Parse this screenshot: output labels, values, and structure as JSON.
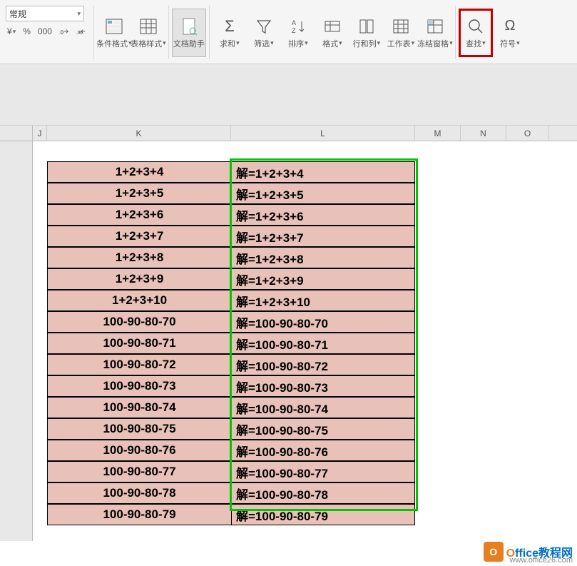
{
  "ribbon": {
    "format_name": "常规",
    "currency": "¥",
    "percent": "%",
    "comma": "000",
    "dec_inc": ".0→.00",
    "dec_dec": ".00→.0",
    "cond_format": "条件格式",
    "table_style": "表格样式",
    "doc_helper": "文档助手",
    "sum": "求和",
    "filter": "筛选",
    "sort": "排序",
    "format": "格式",
    "rowcol": "行和列",
    "worksheet": "工作表",
    "freeze": "冻结窗格",
    "find": "查找",
    "symbol": "符号"
  },
  "columns": {
    "J": "J",
    "K": "K",
    "L": "L",
    "M": "M",
    "N": "N",
    "O": "O"
  },
  "rows": [
    {
      "k": "1+2+3+4",
      "l": "解=1+2+3+4"
    },
    {
      "k": "1+2+3+5",
      "l": "解=1+2+3+5"
    },
    {
      "k": "1+2+3+6",
      "l": "解=1+2+3+6"
    },
    {
      "k": "1+2+3+7",
      "l": "解=1+2+3+7"
    },
    {
      "k": "1+2+3+8",
      "l": "解=1+2+3+8"
    },
    {
      "k": "1+2+3+9",
      "l": "解=1+2+3+9"
    },
    {
      "k": "1+2+3+10",
      "l": "解=1+2+3+10"
    },
    {
      "k": "100-90-80-70",
      "l": "解=100-90-80-70"
    },
    {
      "k": "100-90-80-71",
      "l": "解=100-90-80-71"
    },
    {
      "k": "100-90-80-72",
      "l": "解=100-90-80-72"
    },
    {
      "k": "100-90-80-73",
      "l": "解=100-90-80-73"
    },
    {
      "k": "100-90-80-74",
      "l": "解=100-90-80-74"
    },
    {
      "k": "100-90-80-75",
      "l": "解=100-90-80-75"
    },
    {
      "k": "100-90-80-76",
      "l": "解=100-90-80-76"
    },
    {
      "k": "100-90-80-77",
      "l": "解=100-90-80-77"
    },
    {
      "k": "100-90-80-78",
      "l": "解=100-90-80-78"
    }
  ],
  "last_row": {
    "k": "100-90-80-79",
    "l": "解=100-90-80-79"
  },
  "watermark": {
    "brand": "Office教程网",
    "url": "www.office26.com"
  }
}
